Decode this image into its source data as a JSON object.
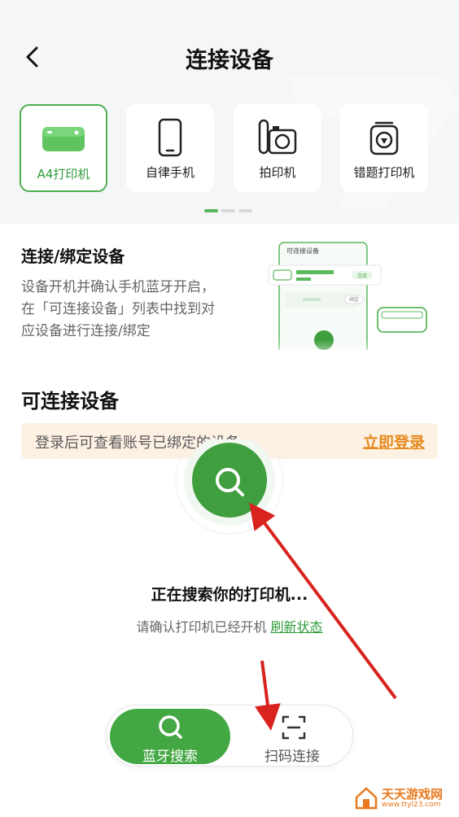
{
  "nav": {
    "title": "连接设备"
  },
  "categories": [
    {
      "label": "A4打印机",
      "icon": "printer-icon",
      "active": true
    },
    {
      "label": "自律手机",
      "icon": "phone-icon",
      "active": false
    },
    {
      "label": "拍印机",
      "icon": "camera-printer-icon",
      "active": false
    },
    {
      "label": "错题打印机",
      "icon": "mini-printer-icon",
      "active": false
    }
  ],
  "intro": {
    "title": "连接/绑定设备",
    "desc": "设备开机并确认手机蓝牙开启，在「可连接设备」列表中找到对应设备进行连接/绑定",
    "illustration_header": "可连接设备",
    "illustration_btn1": "连接",
    "illustration_btn2": "绑定"
  },
  "section": {
    "title": "可连接设备"
  },
  "login_bar": {
    "text": "登录后可查看账号已绑定的设备",
    "link": "立即登录"
  },
  "search": {
    "status": "正在搜索你的打印机...",
    "hint": "请确认打印机已经开机",
    "refresh": "刷新状态"
  },
  "bottom": {
    "bluetooth_label": "蓝牙搜索",
    "scan_label": "扫码连接"
  },
  "watermark": {
    "main": "天天游戏网",
    "sub": "www.ttyl23.com"
  },
  "colors": {
    "accent": "#43a843",
    "link_orange": "#e58a1c",
    "arrow_red": "#d9231f"
  }
}
